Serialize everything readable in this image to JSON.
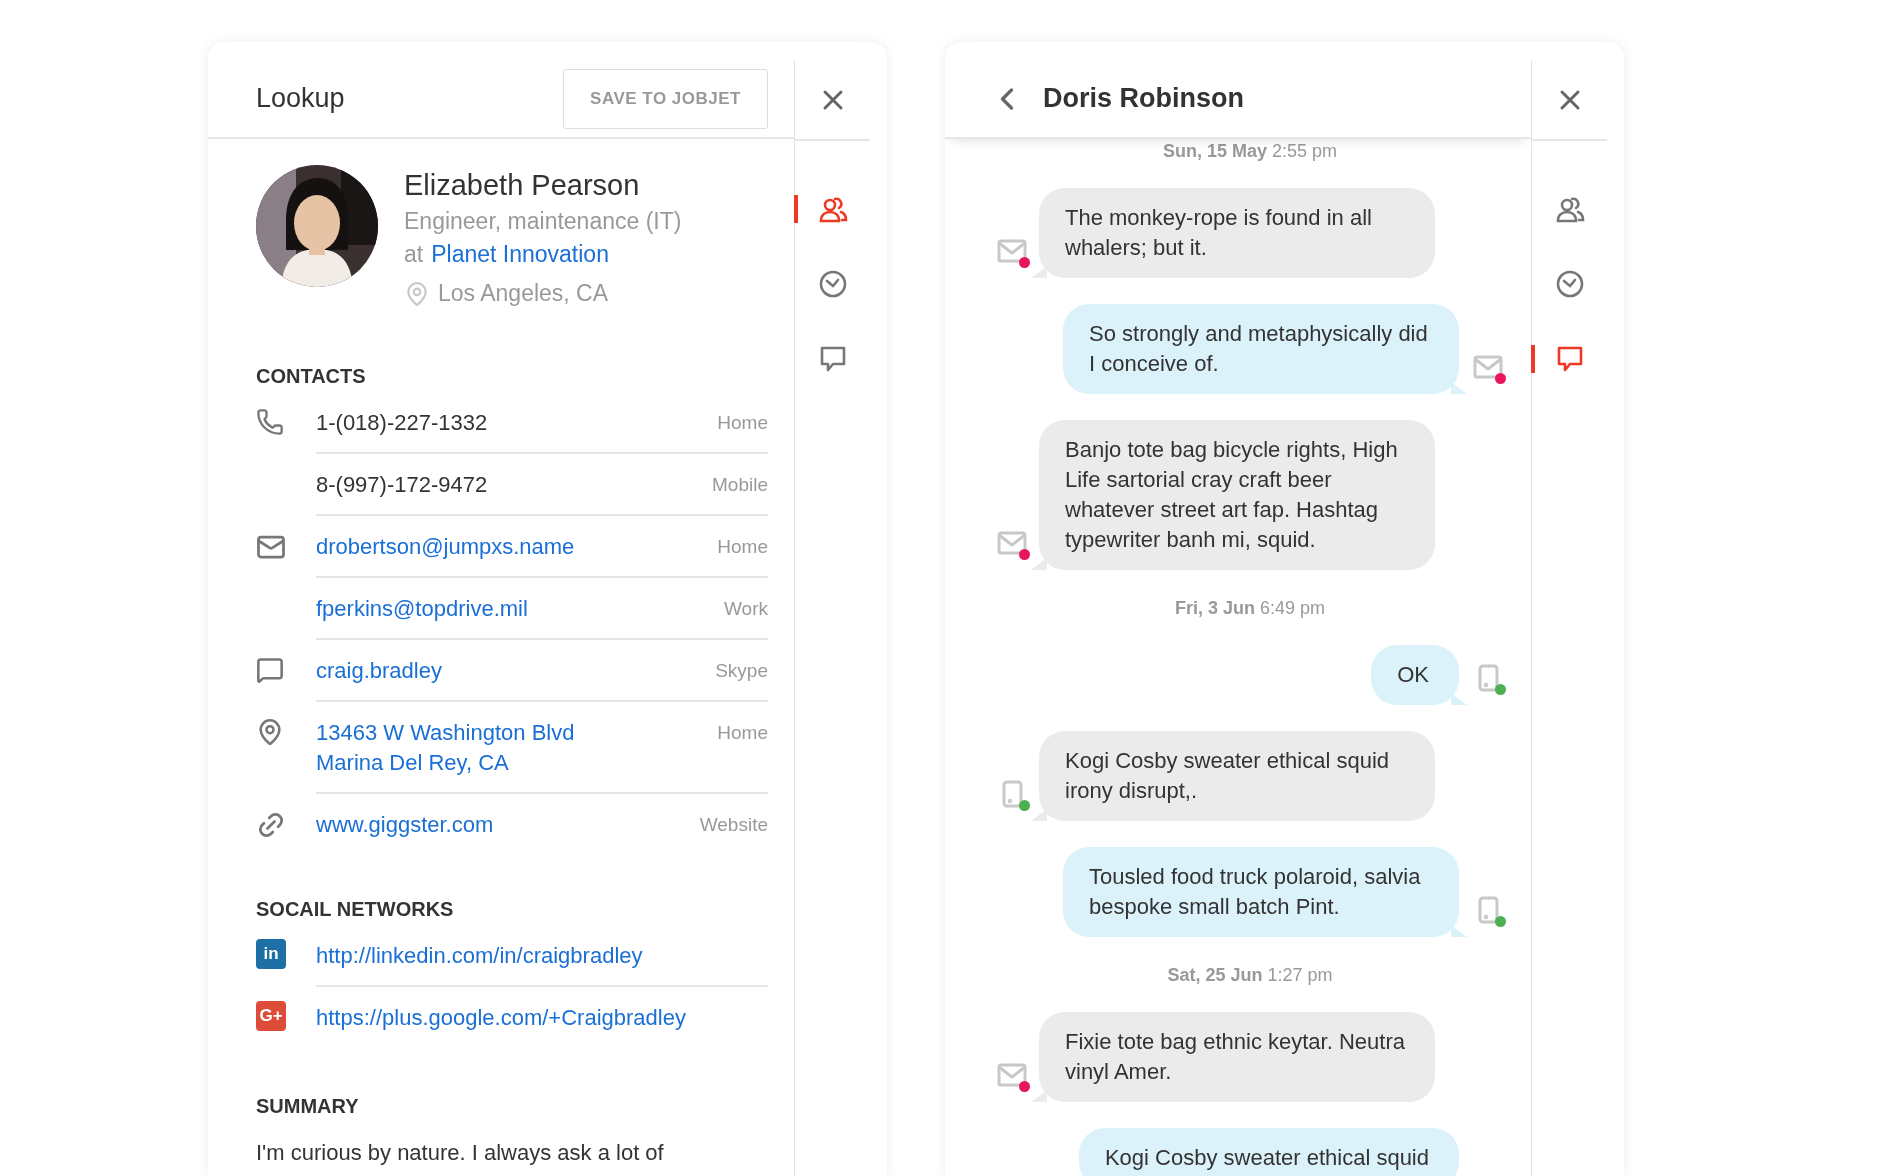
{
  "lookup": {
    "title": "Lookup",
    "save_button": "SAVE TO JOBJET",
    "profile": {
      "name": "Elizabeth Pearson",
      "job_title": "Engineer, maintenance (IT)",
      "at": "at",
      "company": "Planet Innovation",
      "location": "Los Angeles, CA"
    },
    "contacts_heading": "CONTACTS",
    "contacts": [
      {
        "kind": "phone",
        "entries": [
          {
            "lines": [
              "1-(018)-227-1332"
            ],
            "label": "Home",
            "link": false
          },
          {
            "lines": [
              "8-(997)-172-9472"
            ],
            "label": "Mobile",
            "link": false
          }
        ]
      },
      {
        "kind": "email",
        "entries": [
          {
            "lines": [
              "drobertson@jumpxs.name"
            ],
            "label": "Home",
            "link": true
          },
          {
            "lines": [
              "fperkins@topdrive.mil"
            ],
            "label": "Work",
            "link": true
          }
        ]
      },
      {
        "kind": "chat",
        "entries": [
          {
            "lines": [
              "craig.bradley"
            ],
            "label": "Skype",
            "link": true
          }
        ]
      },
      {
        "kind": "address",
        "entries": [
          {
            "lines": [
              "13463 W Washington Blvd",
              "Marina Del Rey, CA"
            ],
            "label": "Home",
            "link": true
          }
        ]
      },
      {
        "kind": "web",
        "entries": [
          {
            "lines": [
              "www.giggster.com"
            ],
            "label": "Website",
            "link": true
          }
        ]
      }
    ],
    "social_heading": "SOCAIL NETWORKS",
    "social": [
      {
        "kind": "linkedin",
        "icon_text": "in",
        "url": "http://linkedin.com/in/craigbradley"
      },
      {
        "kind": "googleplus",
        "icon_text": "G+",
        "url": "https://plus.google.com/+Craigbradley"
      }
    ],
    "summary_heading": "SUMMARY",
    "summary": "I'm curious by nature. I always ask a lot of",
    "rail": [
      {
        "kind": "profile",
        "selected": true
      },
      {
        "kind": "history",
        "selected": false
      },
      {
        "kind": "chat",
        "selected": false
      }
    ]
  },
  "conversation": {
    "title": "Doris Robinson",
    "items": [
      {
        "kind": "date",
        "day": "Sun, 15 May",
        "time": "2:55 pm"
      },
      {
        "kind": "message",
        "sent": false,
        "status": {
          "kind": "email",
          "color": "#e8175d"
        },
        "text": "The monkey-rope is found in all whalers; but it."
      },
      {
        "kind": "message",
        "sent": true,
        "status": {
          "kind": "email",
          "color": "#e8175d"
        },
        "text": "So strongly and metaphysically did I conceive of."
      },
      {
        "kind": "message",
        "sent": false,
        "status": {
          "kind": "email",
          "color": "#e8175d"
        },
        "text": "Banjo tote bag bicycle rights, High Life sartorial cray craft beer whatever street art fap. Hashtag typewriter banh mi, squid."
      },
      {
        "kind": "date",
        "day": "Fri, 3 Jun",
        "time": "6:49 pm"
      },
      {
        "kind": "message",
        "sent": true,
        "status": {
          "kind": "mobile",
          "color": "#4caf50"
        },
        "text": "OK"
      },
      {
        "kind": "message",
        "sent": false,
        "status": {
          "kind": "mobile",
          "color": "#4caf50"
        },
        "text": "Kogi Cosby sweater ethical squid irony disrupt,."
      },
      {
        "kind": "message",
        "sent": true,
        "status": {
          "kind": "mobile",
          "color": "#4caf50"
        },
        "text": "Tousled food truck polaroid, salvia bespoke small batch Pint."
      },
      {
        "kind": "date",
        "day": "Sat, 25 Jun",
        "time": "1:27 pm"
      },
      {
        "kind": "message",
        "sent": false,
        "status": {
          "kind": "email",
          "color": "#e8175d"
        },
        "text": "Fixie tote bag ethnic keytar. Neutra vinyl Amer."
      },
      {
        "kind": "message",
        "sent": true,
        "text": "Kogi Cosby sweater ethical squid"
      }
    ],
    "rail": [
      {
        "kind": "profile",
        "selected": false
      },
      {
        "kind": "history",
        "selected": false
      },
      {
        "kind": "chat",
        "selected": true
      }
    ]
  }
}
